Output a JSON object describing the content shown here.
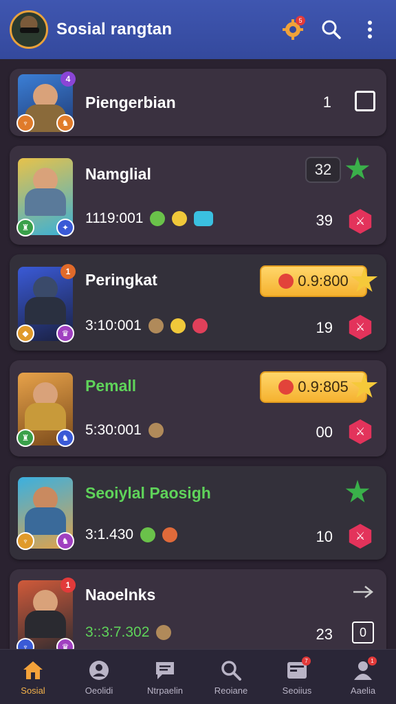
{
  "header": {
    "title": "Sosial rangtan",
    "settings_badge": "5",
    "icons": [
      "gear-icon",
      "search-icon",
      "more-vert-icon"
    ]
  },
  "rows": [
    {
      "name": "Piengerbian",
      "count": "1",
      "badge_tr": "4",
      "action": "checkbox-icon"
    },
    {
      "name": "Namglial",
      "score": "1119:001",
      "count": "39",
      "pill": "32",
      "action": "hex-icon"
    },
    {
      "name": "Peringkat",
      "score": "3:10:001",
      "count": "19",
      "pill": "0.9:800",
      "badge_tr": "1",
      "action": "hex-icon"
    },
    {
      "name": "Pemall",
      "score": "5:30:001",
      "count": "00",
      "pill": "0.9:805",
      "action": "hex-icon"
    },
    {
      "name": "Seoiylal Paosigh",
      "score": "3:1.430",
      "count": "10",
      "action": "hex-icon"
    },
    {
      "name": "Naoelnks",
      "score": "3::3:7.302",
      "count": "23",
      "badge_tr": "1",
      "action": "arrow-right-icon"
    }
  ],
  "nav": [
    {
      "label": "Sosial",
      "icon": "home-icon",
      "active": true
    },
    {
      "label": "Oeolidi",
      "icon": "person-circle-icon"
    },
    {
      "label": "Ntrpaelin",
      "icon": "chat-icon"
    },
    {
      "label": "Reoiane",
      "icon": "search-icon"
    },
    {
      "label": "Seoiius",
      "icon": "inbox-icon",
      "badge": "7"
    },
    {
      "label": "Aaelia",
      "icon": "person-icon",
      "badge": "1"
    }
  ]
}
